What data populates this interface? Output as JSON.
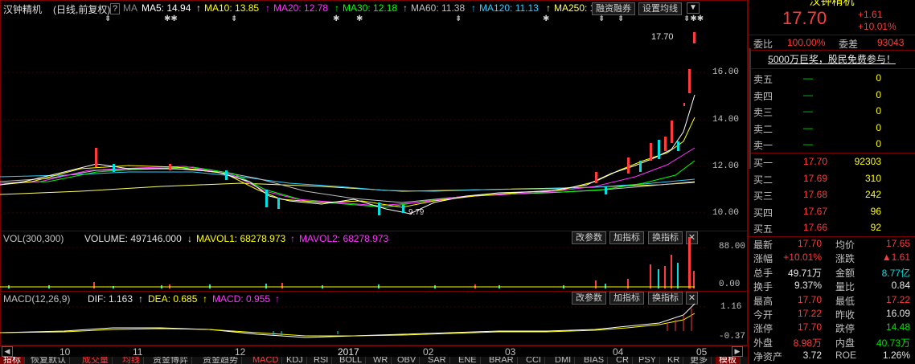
{
  "title": {
    "name": "汉钟精机",
    "mode": "(日线,前复权)",
    "help_icon": "?",
    "ma_label": "MA",
    "ma5": "MA5: 14.94",
    "ma10": "MA10: 13.85",
    "ma20": "MA20: 12.78",
    "ma30": "MA30: 12.18",
    "ma60": "MA60: 11.38",
    "ma120": "MA120: 11.13",
    "ma250": "MA250: 1",
    "financing_btn": "融资融券",
    "ma_setting_btn": "设置均线"
  },
  "colors": {
    "up": "#ff3b3b",
    "down": "#00e0e0",
    "ma5": "#ffffff",
    "ma10": "#ffff00",
    "ma20": "#ff33ff",
    "ma30": "#00ff00",
    "ma60": "#c0c0c0",
    "ma120": "#33ccff",
    "ma250": "#ffff66"
  },
  "main_chart": {
    "price_axis": [
      "16.00",
      "14.00",
      "12.00",
      "10.00"
    ],
    "high_label": "17.70",
    "low_label": "9.79"
  },
  "volume": {
    "label": "VOL(300,300)",
    "volume": "VOLUME: 497146.000",
    "mavol1": "MAVOL1: 68278.973",
    "mavol2": "MAVOL2: 68278.973",
    "axis": [
      "88.00",
      "0.00"
    ],
    "buttons": [
      "改参数",
      "加指标",
      "换指标"
    ]
  },
  "macd": {
    "label": "MACD(12,26,9)",
    "dif": "DIF: 1.163",
    "dea": "DEA: 0.685",
    "macd": "MACD: 0.955",
    "axis": [
      "1.16",
      "-0.37"
    ],
    "buttons": [
      "改参数",
      "加指标",
      "换指标"
    ]
  },
  "time_axis": [
    "10",
    "11",
    "12",
    "2017",
    "02",
    "03",
    "04",
    "05"
  ],
  "bottom_tabs": [
    "指标",
    "恢复默认",
    "成交量",
    "均线",
    "资金博弈",
    "资金趋势",
    "MACD",
    "KDJ",
    "RSI",
    "BOLL",
    "WR",
    "OBV",
    "SAR",
    "ENE",
    "BRAR",
    "CCI",
    "DMI",
    "BIAS",
    "CR",
    "PSY",
    "KR",
    "更多",
    "模板"
  ],
  "quote": {
    "name": "汉钟精机",
    "price": "17.70",
    "change": "+1.61",
    "change_pct": "+10.01%",
    "weibi_label": "委比",
    "weibi": "100.00%",
    "weicha_label": "委差",
    "weicha": "93043",
    "ad": "5000万巨奖，股民免费参与！",
    "sells": [
      {
        "label": "卖五",
        "price": "—",
        "vol": "0"
      },
      {
        "label": "卖四",
        "price": "—",
        "vol": "0"
      },
      {
        "label": "卖三",
        "price": "—",
        "vol": "0"
      },
      {
        "label": "卖二",
        "price": "—",
        "vol": "0"
      },
      {
        "label": "卖一",
        "price": "—",
        "vol": "0"
      }
    ],
    "buys": [
      {
        "label": "买一",
        "price": "17.70",
        "vol": "92303"
      },
      {
        "label": "买二",
        "price": "17.69",
        "vol": "310"
      },
      {
        "label": "买三",
        "price": "17.68",
        "vol": "242"
      },
      {
        "label": "买四",
        "price": "17.67",
        "vol": "96"
      },
      {
        "label": "买五",
        "price": "17.66",
        "vol": "92"
      }
    ],
    "stats": [
      {
        "l1": "最新",
        "v1": "17.70",
        "c1": "red",
        "l2": "均价",
        "v2": "17.65",
        "c2": "red"
      },
      {
        "l1": "涨幅",
        "v1": "+10.01%",
        "c1": "red",
        "l2": "涨跌",
        "v2": "▲1.61",
        "c2": "red"
      },
      {
        "l1": "总手",
        "v1": "49.71万",
        "c1": "white",
        "l2": "金额",
        "v2": "8.77亿",
        "c2": "cyan"
      },
      {
        "l1": "换手",
        "v1": "9.37%",
        "c1": "white",
        "l2": "量比",
        "v2": "0.84",
        "c2": "white"
      },
      {
        "l1": "最高",
        "v1": "17.70",
        "c1": "red",
        "l2": "最低",
        "v2": "17.22",
        "c2": "red"
      },
      {
        "l1": "今开",
        "v1": "17.22",
        "c1": "red",
        "l2": "昨收",
        "v2": "16.09",
        "c2": "white"
      },
      {
        "l1": "涨停",
        "v1": "17.70",
        "c1": "red",
        "l2": "跌停",
        "v2": "14.48",
        "c2": "green"
      },
      {
        "l1": "外盘",
        "v1": "8.98万",
        "c1": "red",
        "l2": "内盘",
        "v2": "40.73万",
        "c2": "green"
      },
      {
        "l1": "净资产",
        "v1": "3.72",
        "c1": "white",
        "l2": "ROE",
        "v2": "1.26%",
        "c2": "white"
      }
    ]
  }
}
